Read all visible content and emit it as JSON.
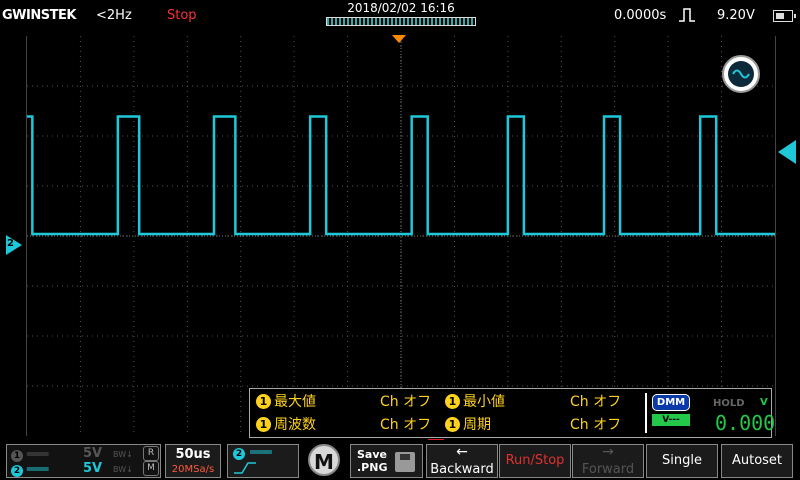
{
  "header": {
    "brand": "GWINSTEK",
    "frequency": "<2Hz",
    "run_state": "Stop",
    "datetime": "2018/02/02  16:16",
    "trigger_time": "0.0000s",
    "trigger_level": "9.20V",
    "icons": [
      "rising-edge-trigger-icon",
      "battery-icon"
    ]
  },
  "display": {
    "ch2_marker_label": "2",
    "trace_color": "#1ec8d8",
    "grid_divisions": {
      "horizontal": 14,
      "vertical": 8
    },
    "waveform": {
      "type": "square",
      "levels_div": [
        0.0,
        2.35
      ],
      "high_segments_x_div": [
        [
          0.02,
          0.1
        ],
        [
          1.7,
          2.1
        ],
        [
          3.5,
          3.9
        ],
        [
          5.3,
          5.6
        ],
        [
          7.2,
          7.5
        ],
        [
          9.0,
          9.3
        ],
        [
          10.8,
          11.1
        ],
        [
          12.6,
          12.9
        ]
      ]
    }
  },
  "measurements": [
    {
      "channel": "1",
      "label": "最大値",
      "value": "Ch オフ"
    },
    {
      "channel": "1",
      "label": "最小値",
      "value": "Ch オフ"
    },
    {
      "channel": "1",
      "label": "周波数",
      "value": "Ch オフ"
    },
    {
      "channel": "1",
      "label": "周期",
      "value": "Ch オフ"
    }
  ],
  "dmm": {
    "badge": "DMM",
    "mode": "V---",
    "hold": "HOLD",
    "hold_unit": "V",
    "value": "0.000"
  },
  "bottom": {
    "ch1": {
      "num": "1",
      "volts": "5V",
      "bw": "BW↓",
      "flag": "R"
    },
    "ch2": {
      "num": "2",
      "volts": "5V",
      "bw": "BW↓",
      "flag": "M"
    },
    "timebase": "50us",
    "sample_rate": "20MSa/s",
    "trigger_channel": "2",
    "menu": "M",
    "save": {
      "line1": "Save",
      "line2": ".PNG"
    },
    "backward": "Backward",
    "run_stop": "Run/Stop",
    "forward": "Forward",
    "single": "Single",
    "autoset": "Autoset"
  }
}
